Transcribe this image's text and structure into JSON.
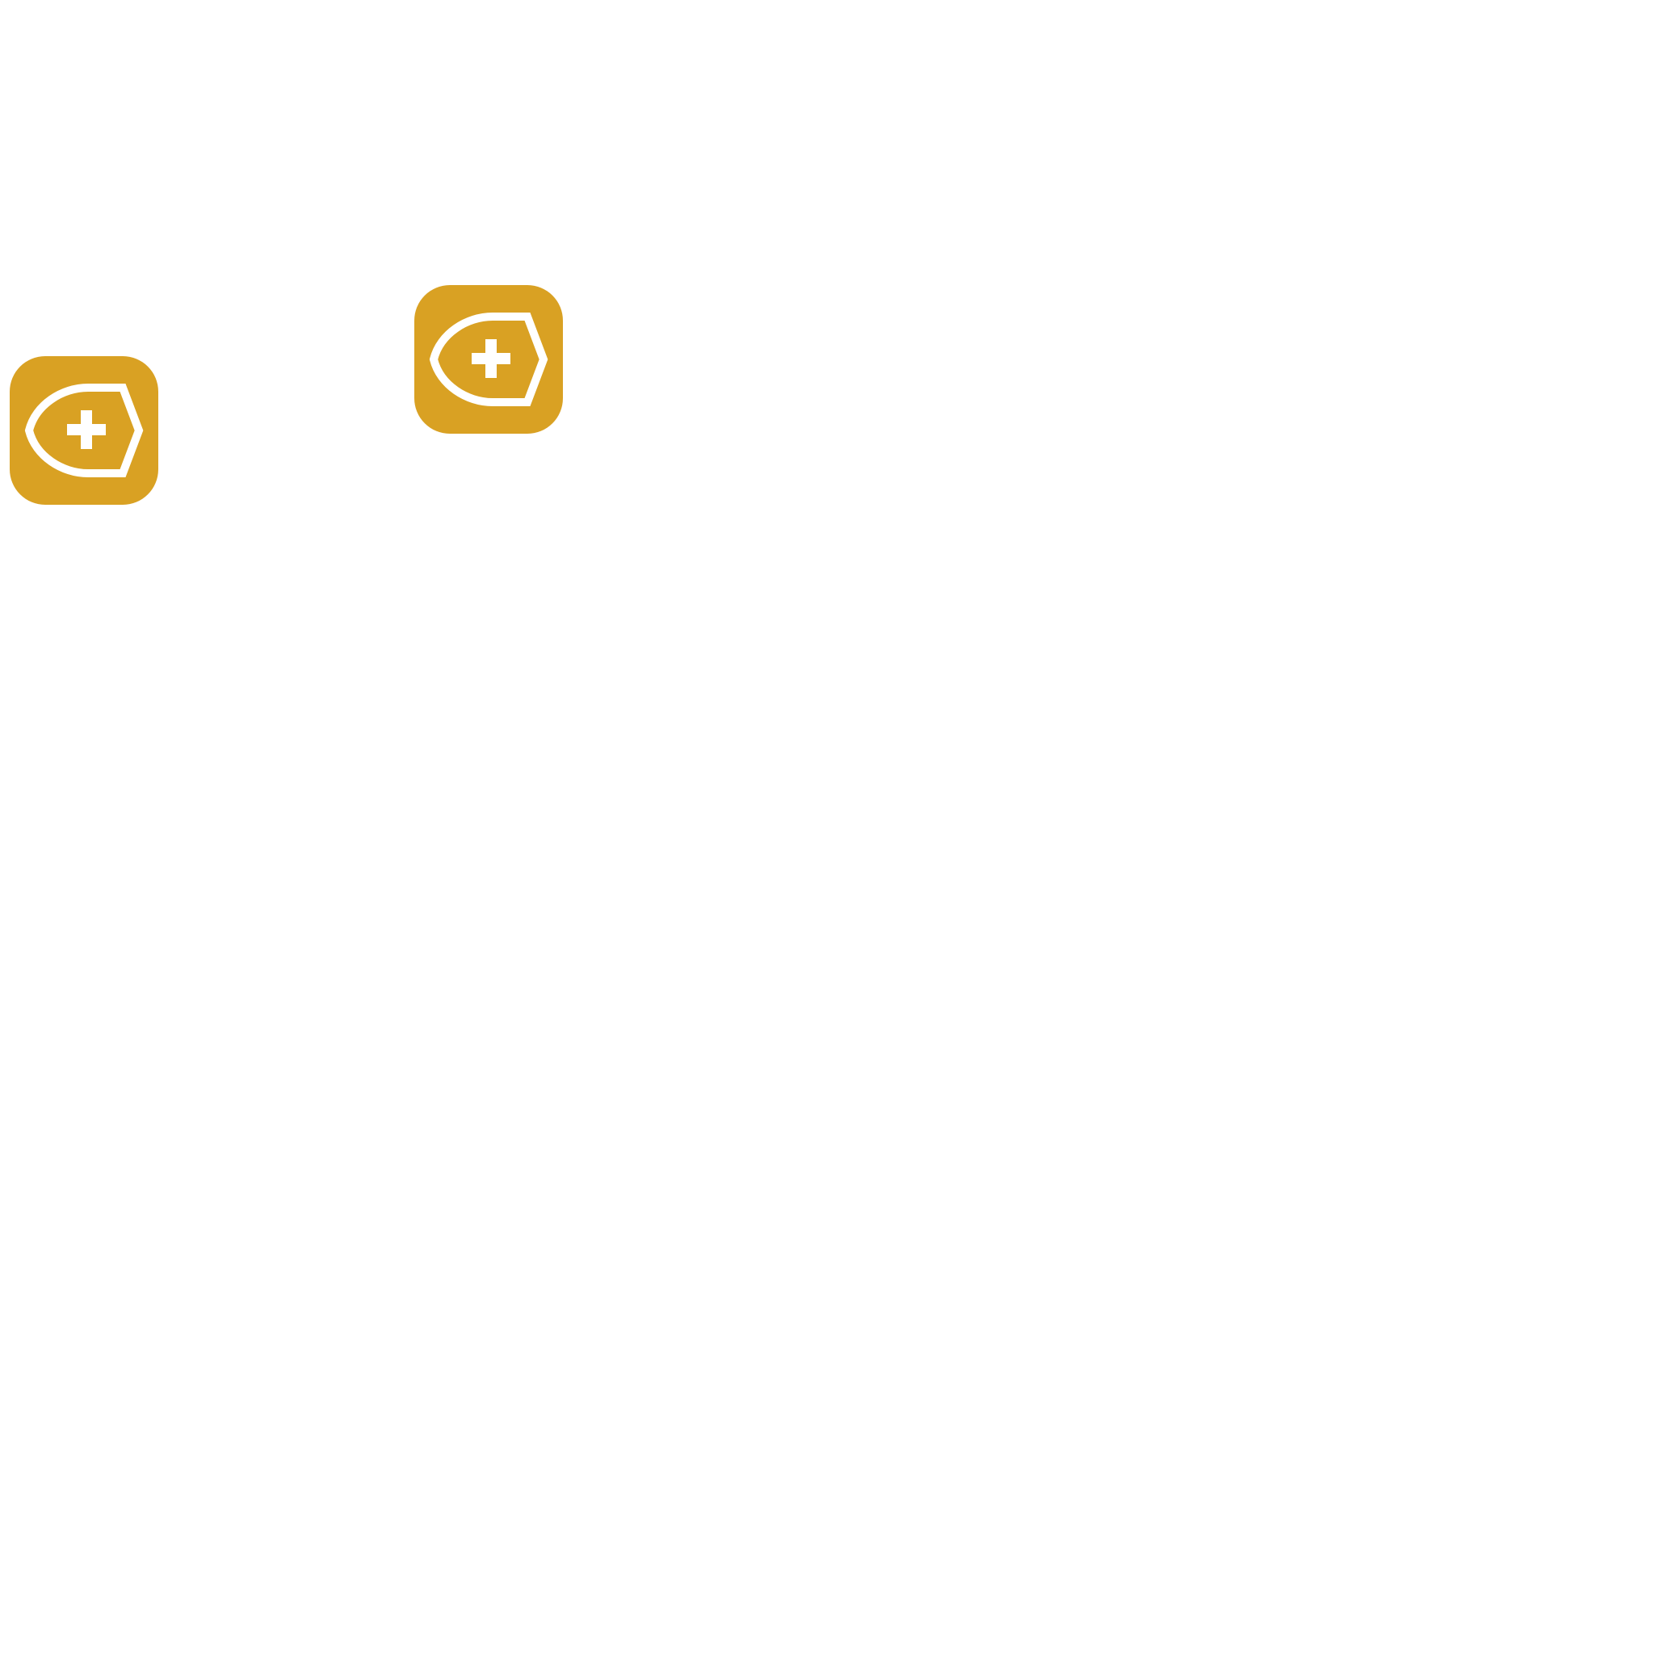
{
  "icons": [
    {
      "icon": "pill-plus-icon",
      "background": "#d9a123",
      "glyph_color": "#ffffff"
    },
    {
      "icon": "pill-plus-icon",
      "background": "#d9a123",
      "glyph_color": "#ffffff"
    }
  ]
}
